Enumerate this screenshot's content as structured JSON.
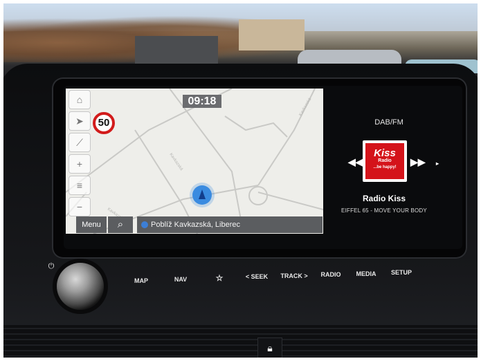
{
  "map": {
    "clock": "09:18",
    "speed_limit": "50",
    "menu_label": "Menu",
    "address": "Poblíž Kavkazská, Liberec",
    "street_labels": [
      "Kavkazská",
      "Kavkazská",
      "Kavkazská"
    ],
    "left_tools": [
      "home-icon",
      "compass-icon",
      "no-route-icon",
      "zoom-in-icon",
      "layers-icon",
      "zoom-out-icon"
    ]
  },
  "radio": {
    "source": "DAB/FM",
    "station": "Radio Kiss",
    "song": "EIFFEL 65 - MOVE YOUR BODY",
    "logo_text": "Kiss",
    "logo_sub": "Radio",
    "logo_tag": "...be happy!"
  },
  "hardware": {
    "buttons": [
      "MAP",
      "NAV",
      "☆",
      "< SEEK",
      "TRACK >",
      "RADIO",
      "MEDIA",
      "SETUP"
    ]
  },
  "colors": {
    "speed_ring": "#d21b1b",
    "radio_logo": "#d4131a",
    "position_marker": "#3a8be0"
  }
}
